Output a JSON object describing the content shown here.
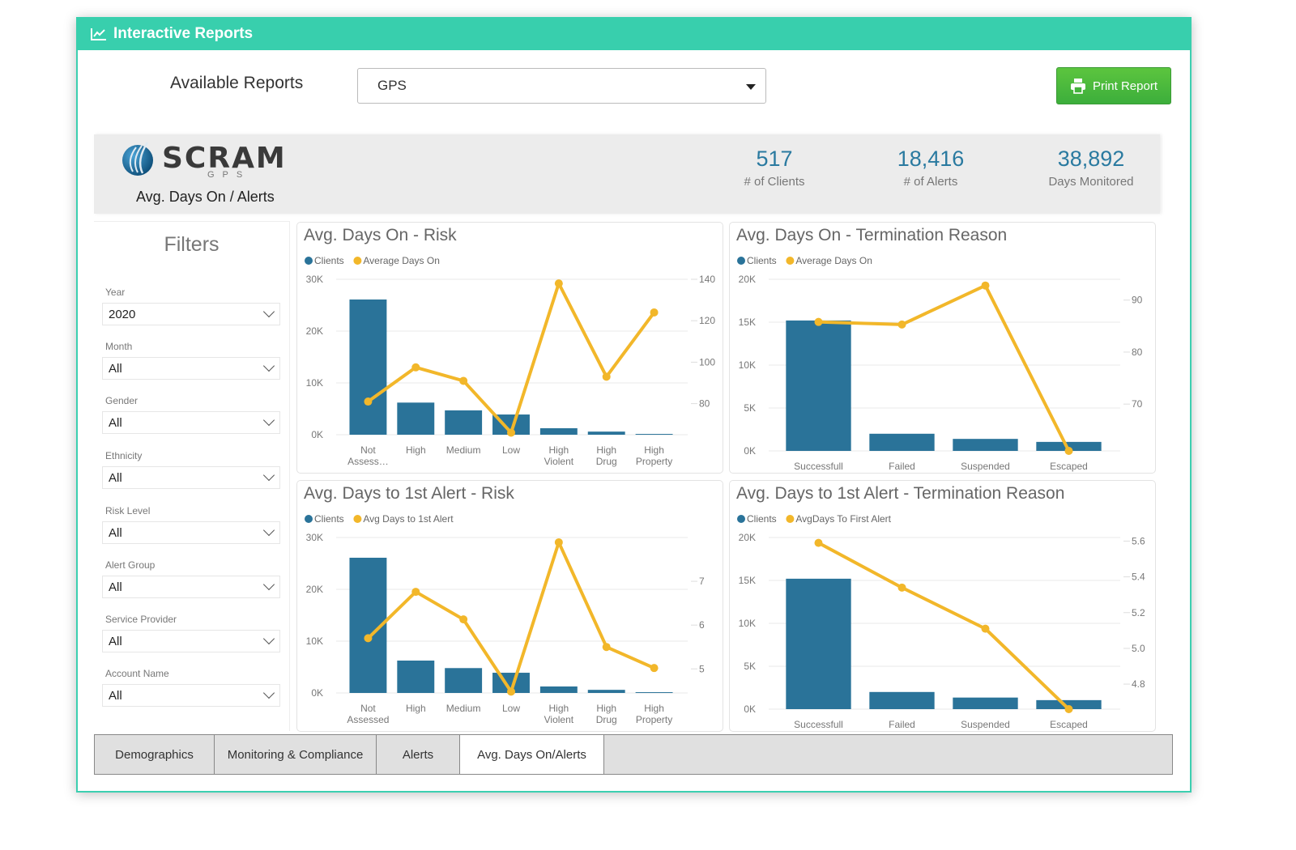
{
  "window": {
    "title": "Interactive Reports",
    "title_icon": "line-chart-icon"
  },
  "toolbar": {
    "available_reports_label": "Available Reports",
    "report_select_value": "GPS",
    "print_button_label": "Print Report",
    "print_icon": "printer-icon"
  },
  "banner": {
    "logo_text": "SCRAM",
    "logo_sub": "GPS",
    "subtitle": "Avg. Days On / Alerts",
    "kpis": [
      {
        "value": "517",
        "label": "# of Clients"
      },
      {
        "value": "18,416",
        "label": "# of Alerts"
      },
      {
        "value": "38,892",
        "label": "Days Monitored"
      }
    ]
  },
  "filters": {
    "title": "Filters",
    "items": [
      {
        "label": "Year",
        "value": "2020"
      },
      {
        "label": "Month",
        "value": "All"
      },
      {
        "label": "Gender",
        "value": "All"
      },
      {
        "label": "Ethnicity",
        "value": "All"
      },
      {
        "label": "Risk Level",
        "value": "All"
      },
      {
        "label": "Alert Group",
        "value": "All"
      },
      {
        "label": "Service Provider",
        "value": "All"
      },
      {
        "label": "Account Name",
        "value": "All"
      }
    ]
  },
  "colors": {
    "bar": "#2a7399",
    "line": "#f2b72a",
    "accent": "#38cfad",
    "kpi": "#2a7aa0",
    "print": "#44b43c"
  },
  "tabs": [
    {
      "label": "Demographics",
      "active": false
    },
    {
      "label": "Monitoring & Compliance",
      "active": false
    },
    {
      "label": "Alerts",
      "active": false
    },
    {
      "label": "Avg. Days On/Alerts",
      "active": true
    }
  ],
  "chart_data": [
    {
      "type": "bar",
      "title": "Avg. Days On - Risk",
      "categories": [
        "Not Assess…",
        "High",
        "Medium",
        "Low",
        "High Violent",
        "High Drug",
        "High Property"
      ],
      "series": [
        {
          "name": "Clients",
          "kind": "bar",
          "axis": "left",
          "values": [
            26100,
            6200,
            4700,
            3900,
            1250,
            600,
            150
          ]
        },
        {
          "name": "Average Days On",
          "kind": "line",
          "axis": "right",
          "values": [
            81,
            97.5,
            91,
            66,
            138,
            93,
            124
          ]
        }
      ],
      "y_left": {
        "min": 0,
        "max": 30000,
        "ticks": [
          0,
          10000,
          20000,
          30000
        ],
        "tick_labels": [
          "0K",
          "10K",
          "20K",
          "30K"
        ]
      },
      "y_right": {
        "min": 65,
        "max": 140,
        "ticks": [
          80,
          100,
          120,
          140
        ],
        "tick_labels": [
          "80",
          "100",
          "120",
          "140"
        ]
      },
      "legend": "top-left",
      "grid": true
    },
    {
      "type": "bar",
      "title": "Avg. Days On - Termination Reason",
      "categories": [
        "Successfull",
        "Failed",
        "Suspended",
        "Escaped"
      ],
      "series": [
        {
          "name": "Clients",
          "kind": "bar",
          "axis": "left",
          "values": [
            15200,
            2000,
            1400,
            1050
          ]
        },
        {
          "name": "Average Days On",
          "kind": "line",
          "axis": "right",
          "values": [
            85.8,
            85.3,
            92.8,
            61
          ]
        }
      ],
      "y_left": {
        "min": 0,
        "max": 20000,
        "ticks": [
          0,
          5000,
          10000,
          15000,
          20000
        ],
        "tick_labels": [
          "0K",
          "5K",
          "10K",
          "15K",
          "20K"
        ]
      },
      "y_right": {
        "min": 61,
        "max": 94,
        "ticks": [
          70,
          80,
          90
        ],
        "tick_labels": [
          "70",
          "80",
          "90"
        ]
      },
      "legend": "top-left",
      "grid": true
    },
    {
      "type": "bar",
      "title": "Avg. Days to 1st Alert - Risk",
      "categories": [
        "Not Assessed",
        "High",
        "Medium",
        "Low",
        "High Violent",
        "High Drug",
        "High Property"
      ],
      "series": [
        {
          "name": "Clients",
          "kind": "bar",
          "axis": "left",
          "values": [
            26100,
            6250,
            4800,
            3900,
            1250,
            600,
            150
          ]
        },
        {
          "name": "Avg Days to 1st Alert",
          "kind": "line",
          "axis": "right",
          "values": [
            5.7,
            6.76,
            6.13,
            4.48,
            7.89,
            5.5,
            5.02
          ]
        }
      ],
      "y_left": {
        "min": 0,
        "max": 30000,
        "ticks": [
          0,
          10000,
          20000,
          30000
        ],
        "tick_labels": [
          "0K",
          "10K",
          "20K",
          "30K"
        ]
      },
      "y_right": {
        "min": 4.45,
        "max": 8.0,
        "ticks": [
          5,
          6,
          7
        ],
        "tick_labels": [
          "5",
          "6",
          "7"
        ]
      },
      "legend": "top-left",
      "grid": true
    },
    {
      "type": "bar",
      "title": "Avg. Days to 1st Alert - Termination Reason",
      "categories": [
        "Successfull",
        "Failed",
        "Suspended",
        "Escaped"
      ],
      "series": [
        {
          "name": "Clients",
          "kind": "bar",
          "axis": "left",
          "values": [
            15200,
            2000,
            1350,
            1050
          ]
        },
        {
          "name": "AvgDays To First Alert",
          "kind": "line",
          "axis": "right",
          "values": [
            5.59,
            5.34,
            5.11,
            4.66
          ]
        }
      ],
      "y_left": {
        "min": 0,
        "max": 20000,
        "ticks": [
          0,
          5000,
          10000,
          15000,
          20000
        ],
        "tick_labels": [
          "0K",
          "5K",
          "10K",
          "15K",
          "20K"
        ]
      },
      "y_right": {
        "min": 4.66,
        "max": 5.62,
        "ticks": [
          4.8,
          5.0,
          5.2,
          5.4,
          5.6
        ],
        "tick_labels": [
          "4.8",
          "5.0",
          "5.2",
          "5.4",
          "5.6"
        ]
      },
      "legend": "top-left",
      "grid": true
    }
  ]
}
